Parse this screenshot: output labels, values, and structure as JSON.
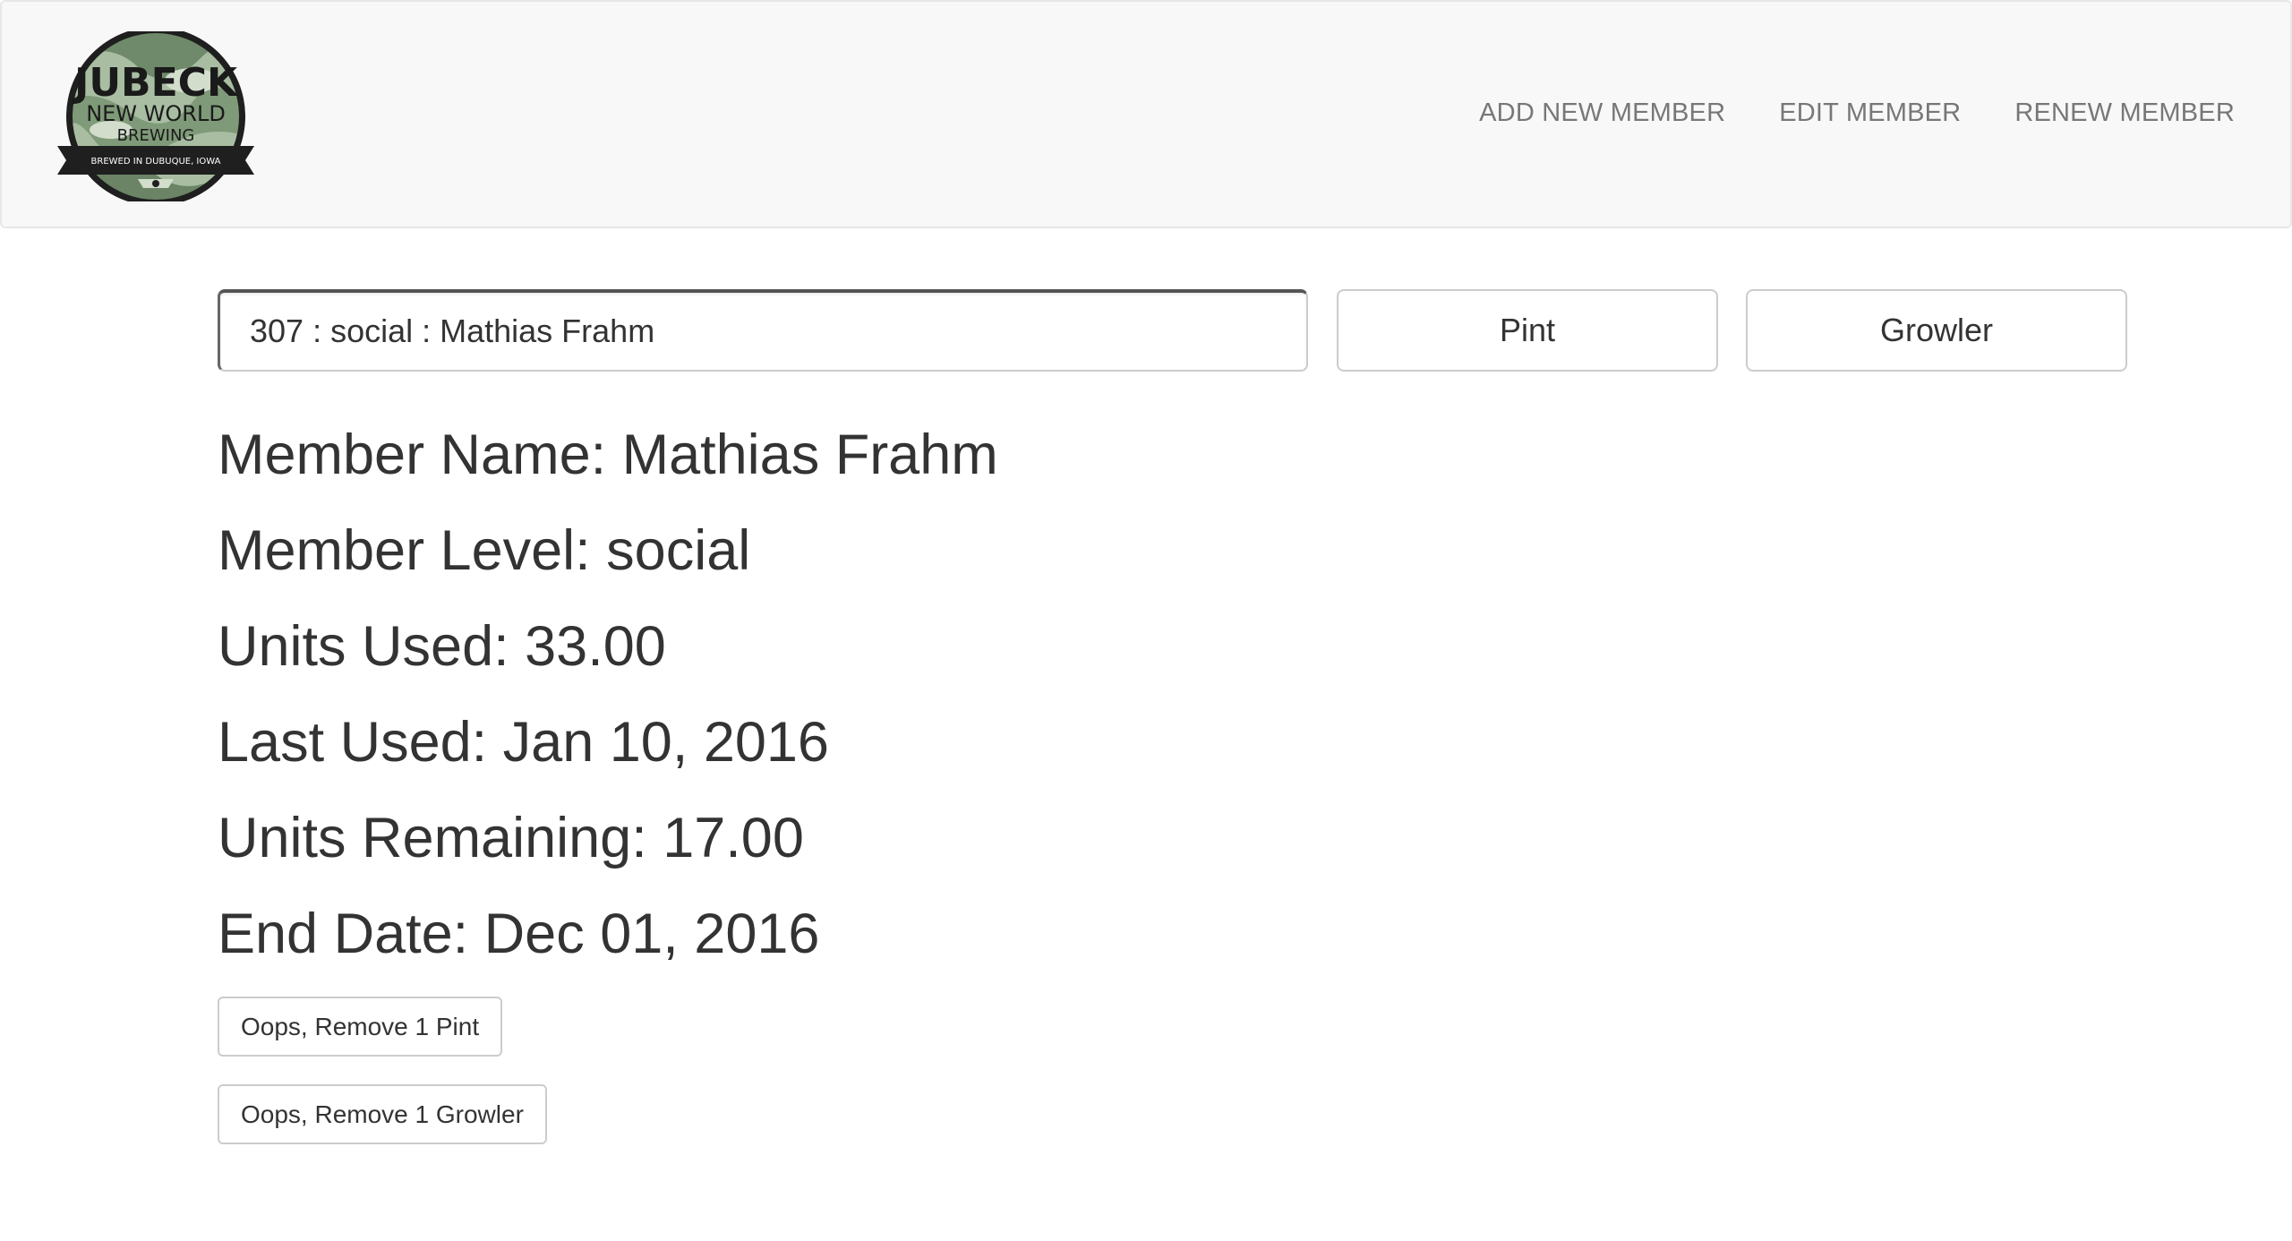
{
  "header": {
    "logo": {
      "line1": "JUBECK",
      "line2": "NEW WORLD",
      "line3": "BREWING",
      "tagline": "BREWED IN DUBUQUE, IOWA",
      "colors": {
        "ring": "#1f1f1f",
        "camo_dark": "#6f8a6a",
        "camo_light": "#b8c9b0",
        "text": "#1a1a1a"
      }
    },
    "nav": [
      {
        "label": "ADD NEW MEMBER"
      },
      {
        "label": "EDIT MEMBER"
      },
      {
        "label": "RENEW MEMBER"
      }
    ]
  },
  "search": {
    "value": "307 : social : Mathias Frahm"
  },
  "actions": {
    "pint_label": "Pint",
    "growler_label": "Growler"
  },
  "member": {
    "name_line": "Member Name: Mathias Frahm",
    "level_line": "Member Level: social",
    "units_used_line": "Units Used: 33.00",
    "last_used_line": "Last Used: Jan 10, 2016",
    "units_remaining_line": "Units Remaining: 17.00",
    "end_date_line": "End Date: Dec 01, 2016"
  },
  "corrections": {
    "remove_pint_label": "Oops, Remove 1 Pint",
    "remove_growler_label": "Oops, Remove 1 Growler"
  },
  "colors": {
    "navbar_bg": "#f8f8f8",
    "nav_text": "#777777",
    "body_text": "#333333",
    "border": "#cccccc"
  }
}
